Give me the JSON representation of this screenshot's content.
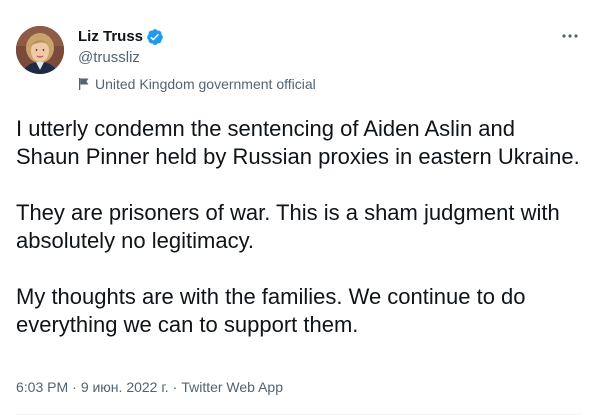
{
  "author": {
    "display_name": "Liz Truss",
    "handle": "@trussliz",
    "label": "United Kingdom government official",
    "verified_icon": "verified-badge-icon",
    "label_icon": "flag-icon"
  },
  "tweet": {
    "paragraphs": [
      "I utterly condemn the sentencing of Aiden Aslin and Shaun Pinner held by Russian proxies in eastern Ukraine.",
      "They are prisoners of war. This is a sham judgment with absolutely no legitimacy.",
      "My thoughts are with the families. We continue to do everything we can to support them."
    ],
    "time": "6:03 PM",
    "date": "9 июн. 2022 г.",
    "source": "Twitter Web App",
    "separator": "·"
  },
  "colors": {
    "text_primary": "#0f1419",
    "text_secondary": "#536471",
    "verified_blue": "#1d9bf0"
  },
  "menu": {
    "more_icon": "more-horizontal-icon"
  }
}
